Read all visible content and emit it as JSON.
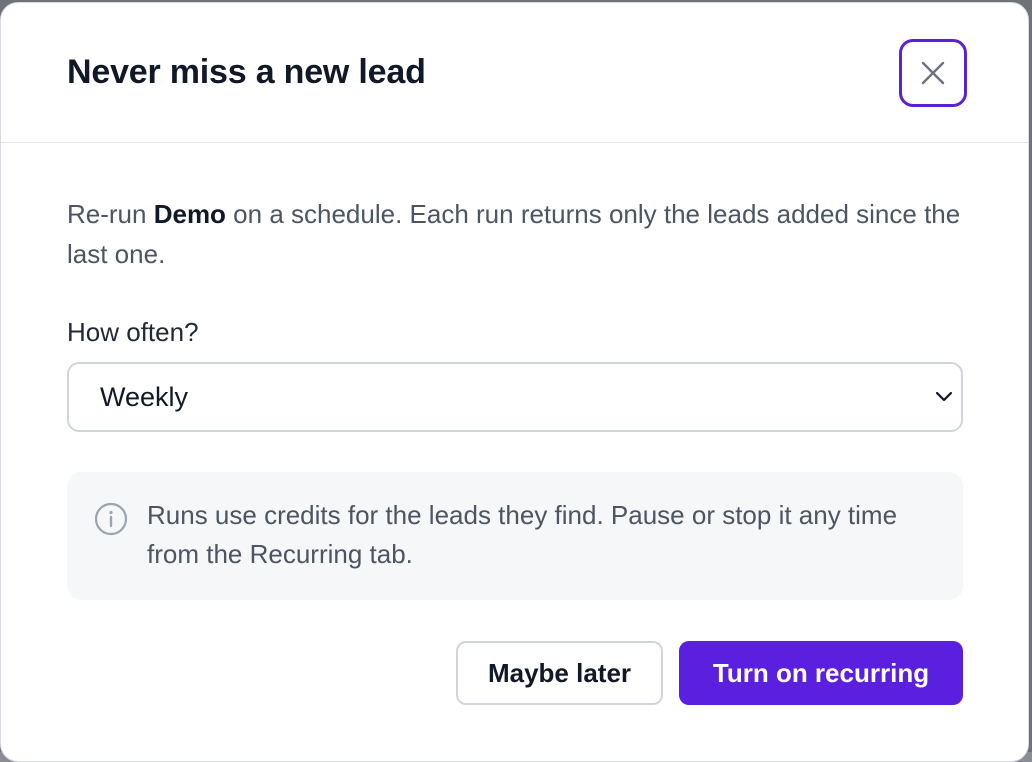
{
  "dialog": {
    "title": "Never miss a new lead",
    "close_icon": "close-icon",
    "description_prefix": "Re-run ",
    "description_strong": "Demo",
    "description_suffix": " on a schedule. Each run returns only the leads added since the last one.",
    "frequency": {
      "label": "How often?",
      "selected": "Weekly",
      "chevron_icon": "chevron-down-icon"
    },
    "info": {
      "icon": "info-icon",
      "text": "Runs use credits for the leads they find. Pause or stop it any time from the Recurring tab."
    },
    "actions": {
      "secondary_label": "Maybe later",
      "primary_label": "Turn on recurring"
    }
  },
  "colors": {
    "accent": "#5b1fe0",
    "focus_ring": "#5b21d6",
    "title": "#111827",
    "body_text": "#4b5563",
    "info_bg": "#f6f7f9"
  }
}
